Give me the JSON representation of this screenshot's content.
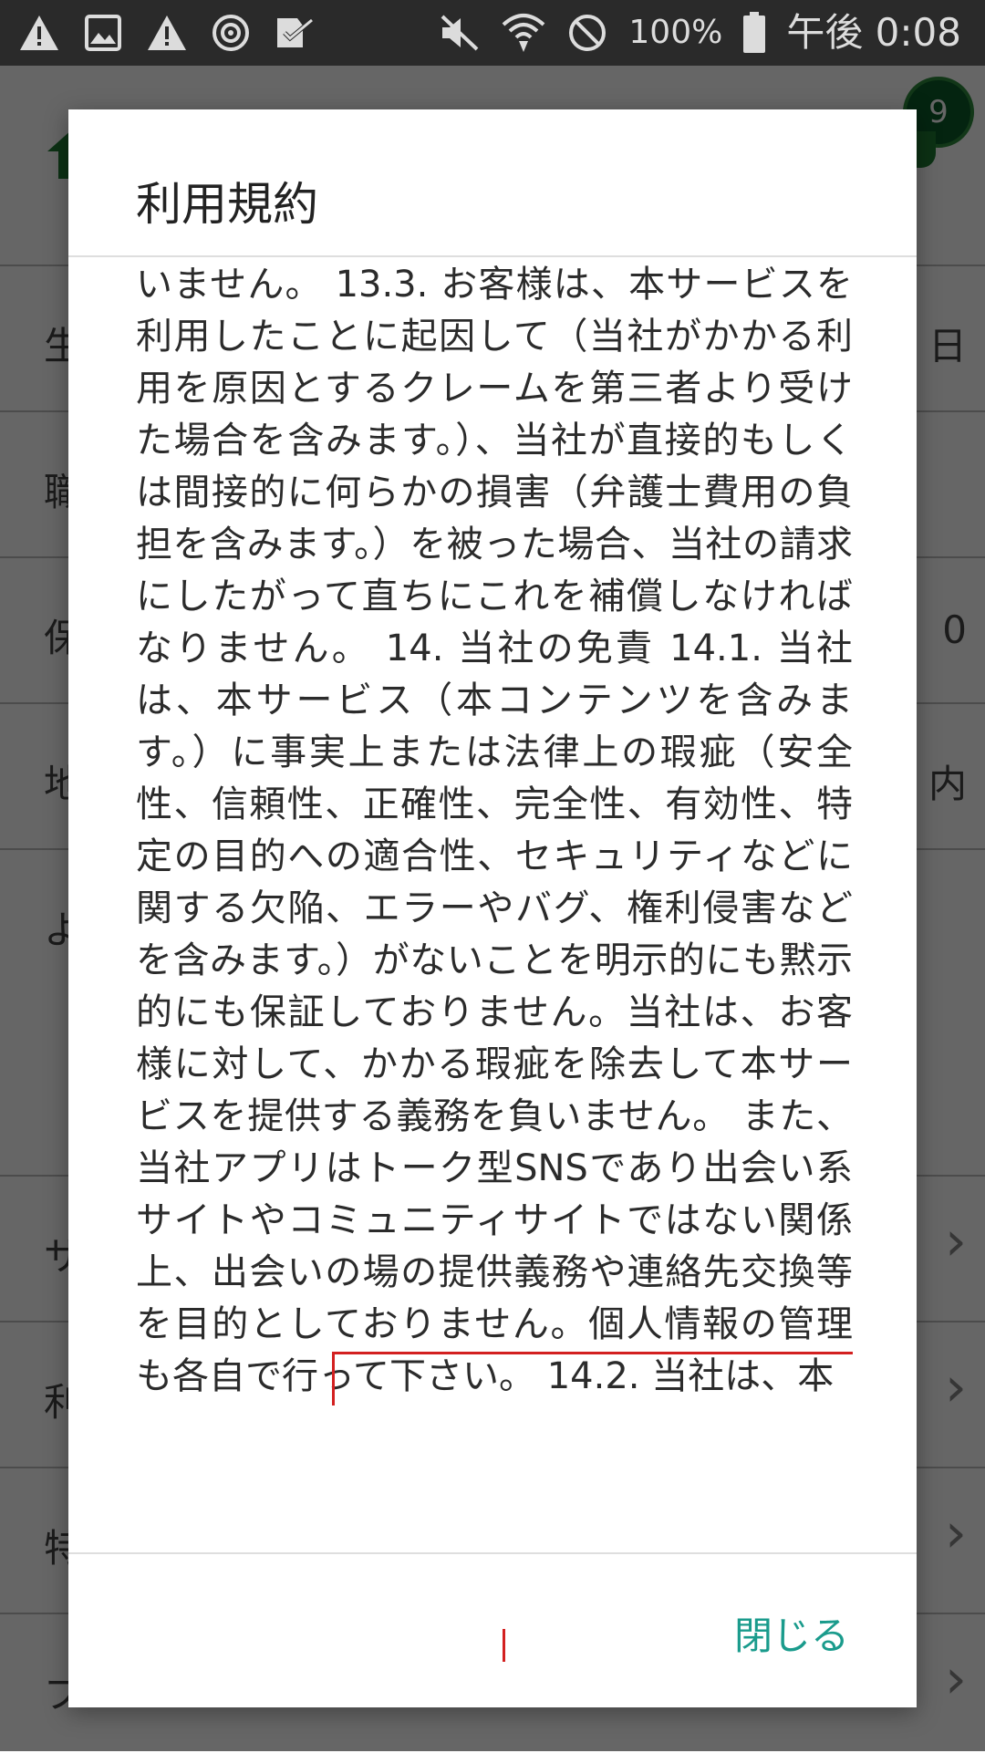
{
  "status_bar": {
    "battery_percent": "100%",
    "time": "午後 0:08"
  },
  "background": {
    "badge_count": "9",
    "rows": [
      {
        "label": "生",
        "value": "日"
      },
      {
        "label": "職",
        "value": ""
      },
      {
        "label": "保",
        "value": "0"
      },
      {
        "label": "地",
        "value": "内"
      },
      {
        "label": "よ",
        "value": ""
      },
      {
        "label": "サ",
        "value": ""
      },
      {
        "label": "利",
        "value": ""
      },
      {
        "label": "特",
        "value": ""
      },
      {
        "label": "プ",
        "value": ""
      }
    ]
  },
  "dialog": {
    "title": "利用規約",
    "body_text": "いません。 13.3. お客様は、本サービスを利用したことに起因して（当社がかかる利用を原因とするクレームを第三者より受けた場合を含みます。）、当社が直接的もしくは間接的に何らかの損害（弁護士費用の負担を含みます。）を被った場合、当社の請求にしたがって直ちにこれを補償しなければなりません。 14. 当社の免責 14.1. 当社は、本サービス（本コンテンツを含みます。）に事実上または法律上の瑕疵（安全性、信頼性、正確性、完全性、有効性、特定の目的への適合性、セキュリティなどに関する欠陥、エラーやバグ、権利侵害などを含みます。）がないことを明示的にも黙示的にも保証しておりません。当社は、お客様に対して、かかる瑕疵を除去して本サービスを提供する義務を負いません。 また、当社アプリはトーク型SNSであり出会い系サイトやコミュニティサイトではない関係上、出会いの場の提供義務や連絡先交換等を目的としておりません。個人情報の管理も各自で行って下さい。 14.2. 当社は、本",
    "close_label": "閉じる"
  }
}
